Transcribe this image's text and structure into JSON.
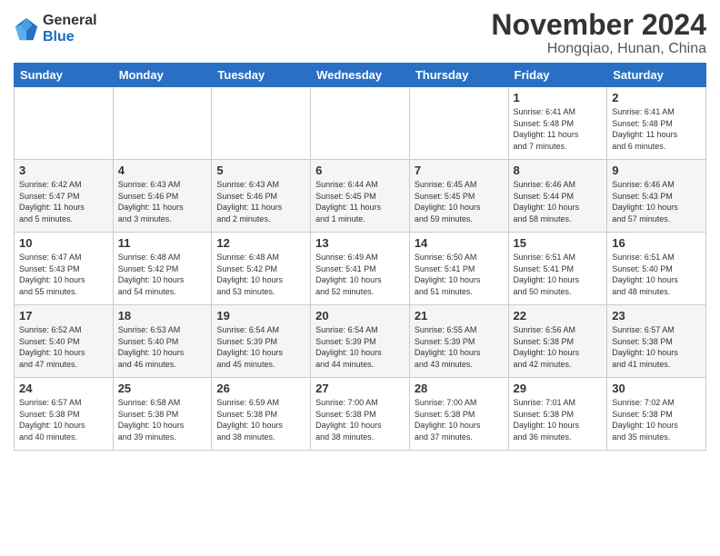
{
  "logo": {
    "line1": "General",
    "line2": "Blue"
  },
  "title": "November 2024",
  "subtitle": "Hongqiao, Hunan, China",
  "weekdays": [
    "Sunday",
    "Monday",
    "Tuesday",
    "Wednesday",
    "Thursday",
    "Friday",
    "Saturday"
  ],
  "weeks": [
    [
      {
        "day": "",
        "info": ""
      },
      {
        "day": "",
        "info": ""
      },
      {
        "day": "",
        "info": ""
      },
      {
        "day": "",
        "info": ""
      },
      {
        "day": "",
        "info": ""
      },
      {
        "day": "1",
        "info": "Sunrise: 6:41 AM\nSunset: 5:48 PM\nDaylight: 11 hours\nand 7 minutes."
      },
      {
        "day": "2",
        "info": "Sunrise: 6:41 AM\nSunset: 5:48 PM\nDaylight: 11 hours\nand 6 minutes."
      }
    ],
    [
      {
        "day": "3",
        "info": "Sunrise: 6:42 AM\nSunset: 5:47 PM\nDaylight: 11 hours\nand 5 minutes."
      },
      {
        "day": "4",
        "info": "Sunrise: 6:43 AM\nSunset: 5:46 PM\nDaylight: 11 hours\nand 3 minutes."
      },
      {
        "day": "5",
        "info": "Sunrise: 6:43 AM\nSunset: 5:46 PM\nDaylight: 11 hours\nand 2 minutes."
      },
      {
        "day": "6",
        "info": "Sunrise: 6:44 AM\nSunset: 5:45 PM\nDaylight: 11 hours\nand 1 minute."
      },
      {
        "day": "7",
        "info": "Sunrise: 6:45 AM\nSunset: 5:45 PM\nDaylight: 10 hours\nand 59 minutes."
      },
      {
        "day": "8",
        "info": "Sunrise: 6:46 AM\nSunset: 5:44 PM\nDaylight: 10 hours\nand 58 minutes."
      },
      {
        "day": "9",
        "info": "Sunrise: 6:46 AM\nSunset: 5:43 PM\nDaylight: 10 hours\nand 57 minutes."
      }
    ],
    [
      {
        "day": "10",
        "info": "Sunrise: 6:47 AM\nSunset: 5:43 PM\nDaylight: 10 hours\nand 55 minutes."
      },
      {
        "day": "11",
        "info": "Sunrise: 6:48 AM\nSunset: 5:42 PM\nDaylight: 10 hours\nand 54 minutes."
      },
      {
        "day": "12",
        "info": "Sunrise: 6:48 AM\nSunset: 5:42 PM\nDaylight: 10 hours\nand 53 minutes."
      },
      {
        "day": "13",
        "info": "Sunrise: 6:49 AM\nSunset: 5:41 PM\nDaylight: 10 hours\nand 52 minutes."
      },
      {
        "day": "14",
        "info": "Sunrise: 6:50 AM\nSunset: 5:41 PM\nDaylight: 10 hours\nand 51 minutes."
      },
      {
        "day": "15",
        "info": "Sunrise: 6:51 AM\nSunset: 5:41 PM\nDaylight: 10 hours\nand 50 minutes."
      },
      {
        "day": "16",
        "info": "Sunrise: 6:51 AM\nSunset: 5:40 PM\nDaylight: 10 hours\nand 48 minutes."
      }
    ],
    [
      {
        "day": "17",
        "info": "Sunrise: 6:52 AM\nSunset: 5:40 PM\nDaylight: 10 hours\nand 47 minutes."
      },
      {
        "day": "18",
        "info": "Sunrise: 6:53 AM\nSunset: 5:40 PM\nDaylight: 10 hours\nand 46 minutes."
      },
      {
        "day": "19",
        "info": "Sunrise: 6:54 AM\nSunset: 5:39 PM\nDaylight: 10 hours\nand 45 minutes."
      },
      {
        "day": "20",
        "info": "Sunrise: 6:54 AM\nSunset: 5:39 PM\nDaylight: 10 hours\nand 44 minutes."
      },
      {
        "day": "21",
        "info": "Sunrise: 6:55 AM\nSunset: 5:39 PM\nDaylight: 10 hours\nand 43 minutes."
      },
      {
        "day": "22",
        "info": "Sunrise: 6:56 AM\nSunset: 5:38 PM\nDaylight: 10 hours\nand 42 minutes."
      },
      {
        "day": "23",
        "info": "Sunrise: 6:57 AM\nSunset: 5:38 PM\nDaylight: 10 hours\nand 41 minutes."
      }
    ],
    [
      {
        "day": "24",
        "info": "Sunrise: 6:57 AM\nSunset: 5:38 PM\nDaylight: 10 hours\nand 40 minutes."
      },
      {
        "day": "25",
        "info": "Sunrise: 6:58 AM\nSunset: 5:38 PM\nDaylight: 10 hours\nand 39 minutes."
      },
      {
        "day": "26",
        "info": "Sunrise: 6:59 AM\nSunset: 5:38 PM\nDaylight: 10 hours\nand 38 minutes."
      },
      {
        "day": "27",
        "info": "Sunrise: 7:00 AM\nSunset: 5:38 PM\nDaylight: 10 hours\nand 38 minutes."
      },
      {
        "day": "28",
        "info": "Sunrise: 7:00 AM\nSunset: 5:38 PM\nDaylight: 10 hours\nand 37 minutes."
      },
      {
        "day": "29",
        "info": "Sunrise: 7:01 AM\nSunset: 5:38 PM\nDaylight: 10 hours\nand 36 minutes."
      },
      {
        "day": "30",
        "info": "Sunrise: 7:02 AM\nSunset: 5:38 PM\nDaylight: 10 hours\nand 35 minutes."
      }
    ]
  ]
}
